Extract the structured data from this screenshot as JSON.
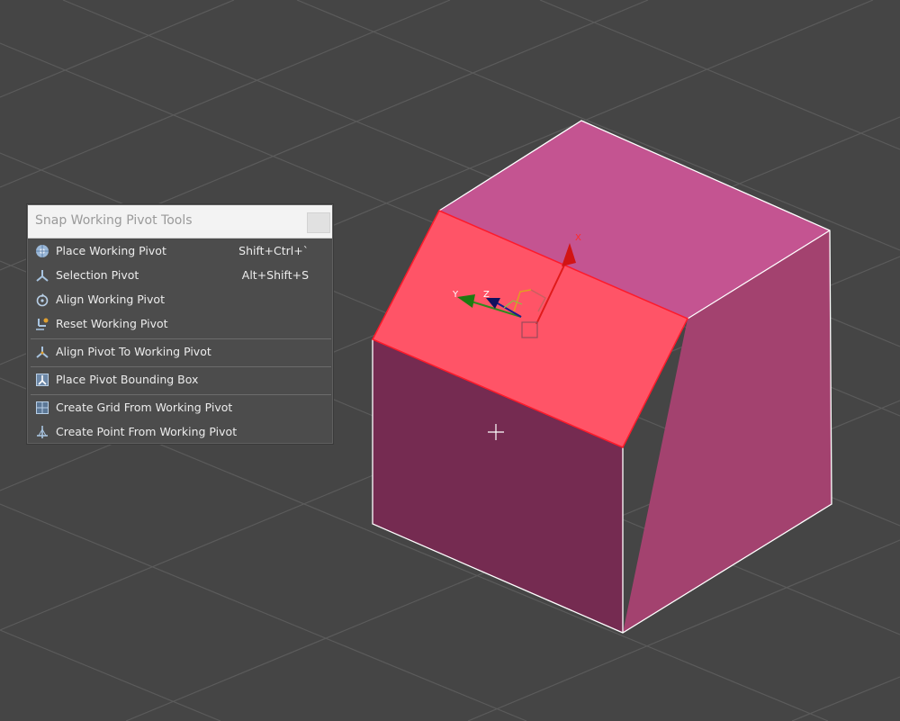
{
  "menu": {
    "title": "Snap Working Pivot Tools",
    "items": [
      {
        "label": "Place Working Pivot",
        "shortcut": "Shift+Ctrl+`",
        "icon": "place-working-pivot-icon"
      },
      {
        "label": "Selection Pivot",
        "shortcut": "Alt+Shift+S",
        "icon": "selection-pivot-icon"
      },
      {
        "label": "Align Working Pivot",
        "shortcut": "",
        "icon": "align-working-pivot-icon"
      },
      {
        "label": "Reset Working Pivot",
        "shortcut": "",
        "icon": "reset-working-pivot-icon"
      },
      {
        "label": "Align Pivot To Working Pivot",
        "shortcut": "",
        "icon": "align-pivot-icon"
      },
      {
        "label": "Place Pivot Bounding Box",
        "shortcut": "",
        "icon": "pivot-bounding-box-icon"
      },
      {
        "label": "Create Grid From Working Pivot",
        "shortcut": "",
        "icon": "create-grid-icon"
      },
      {
        "label": "Create Point From Working Pivot",
        "shortcut": "",
        "icon": "create-point-icon"
      }
    ]
  },
  "gizmo": {
    "x_label": "X",
    "y_label": "Y",
    "z_label": "Z"
  },
  "colors": {
    "viewport_bg": "#454545",
    "grid_line": "#5c5c5c",
    "cube_top": "#c45491",
    "cube_right": "#a3426f",
    "cube_front": "#752b51",
    "selected_face": "#ff5467",
    "axis_x": "#e01a1a",
    "axis_y": "#2f8a1e",
    "axis_z": "#1c1c8a"
  }
}
